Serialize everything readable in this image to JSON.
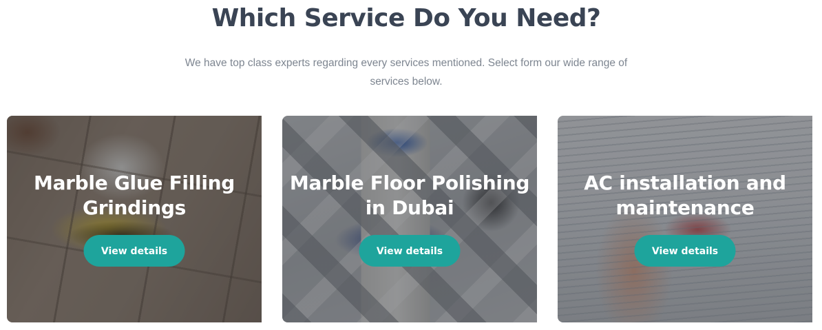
{
  "section": {
    "heading": "Which Service Do You Need?",
    "subtext": "We have top class experts regarding every services mentioned. Select form our wide range of services below."
  },
  "cards": [
    {
      "title_line1": "Marble Glue Filling",
      "title_line2": "Grindings",
      "button_label": "View details"
    },
    {
      "title_line1": "Marble Floor Polishing",
      "title_line2": "in Dubai",
      "button_label": "View details"
    },
    {
      "title_line1": "AC installation and",
      "title_line2": "maintenance",
      "button_label": "View details"
    }
  ],
  "colors": {
    "heading": "#3a4454",
    "subtext": "#7d8590",
    "button": "#1ea49c",
    "button_text": "#ffffff"
  }
}
